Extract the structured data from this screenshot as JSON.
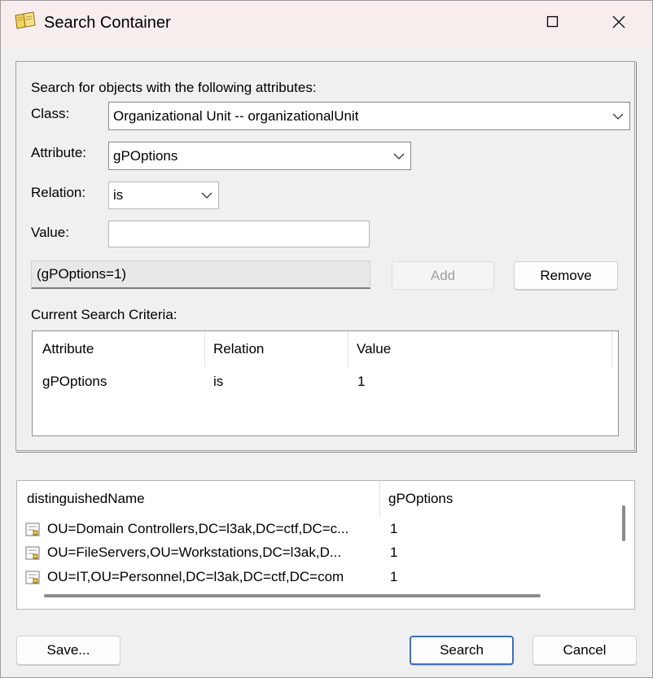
{
  "window": {
    "title": "Search Container",
    "icon": "book-icon",
    "controls": [
      "maximize-icon",
      "close-icon"
    ]
  },
  "form": {
    "heading": "Search for objects with the following attributes:",
    "class_label": "Class:",
    "class_value": "Organizational Unit  --  organizationalUnit",
    "attribute_label": "Attribute:",
    "attribute_value": "gPOptions",
    "relation_label": "Relation:",
    "relation_value": "is",
    "value_label": "Value:",
    "value_value": "",
    "filter_preview": "(gPOptions=1)",
    "add_label": "Add",
    "remove_label": "Remove",
    "criteria_label": "Current Search Criteria:"
  },
  "criteria": {
    "columns": [
      "Attribute",
      "Relation",
      "Value"
    ],
    "rows": [
      {
        "attribute": "gPOptions",
        "relation": "is",
        "value": "1"
      }
    ]
  },
  "results": {
    "columns": [
      "distinguishedName",
      "gPOptions"
    ],
    "rows": [
      {
        "dn": "OU=Domain Controllers,DC=l3ak,DC=ctf,DC=c...",
        "gpoptions": "1",
        "icon": "ou-icon"
      },
      {
        "dn": "OU=FileServers,OU=Workstations,DC=l3ak,D...",
        "gpoptions": "1",
        "icon": "ou-icon"
      },
      {
        "dn": "OU=IT,OU=Personnel,DC=l3ak,DC=ctf,DC=com",
        "gpoptions": "1",
        "icon": "ou-icon"
      }
    ]
  },
  "footer": {
    "save_label": "Save...",
    "search_label": "Search",
    "cancel_label": "Cancel"
  },
  "colors": {
    "titlebar": "#f7eded",
    "dialog_bg": "#f0f0f0",
    "default_button_border": "#3a6fc4"
  }
}
